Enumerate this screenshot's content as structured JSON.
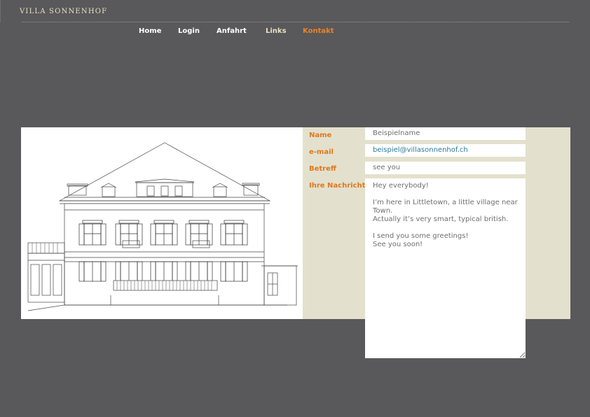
{
  "brand": {
    "name": "VILLA SONNENHOF"
  },
  "nav": {
    "items": [
      {
        "label": "Home"
      },
      {
        "label": "Login"
      },
      {
        "label": "Anfahrt"
      },
      {
        "label": "Links"
      },
      {
        "label": "Kontakt"
      }
    ],
    "active": "Kontakt"
  },
  "form": {
    "name_label": "Name",
    "name_value": "Beispielname",
    "email_label": "e-mail",
    "email_value": "beispiel@villasonnenhof.ch",
    "subject_label": "Betreff",
    "subject_value": "see you",
    "message_label": "Ihre Nachricht",
    "message_value": "Hey everybody!\n\nI’m here in Littletown, a little village near Town.\nActually it’s very smart, typical british.\n\nI send you some greetings!\nSee you soon!"
  },
  "colors": {
    "background": "#59585a",
    "brand": "#e6e1c4",
    "nav_text": "#ffffff",
    "nav_active": "#e8852a",
    "panel": "#e3e1cd",
    "label": "#e0781e",
    "email_text": "#2b7a9a"
  }
}
